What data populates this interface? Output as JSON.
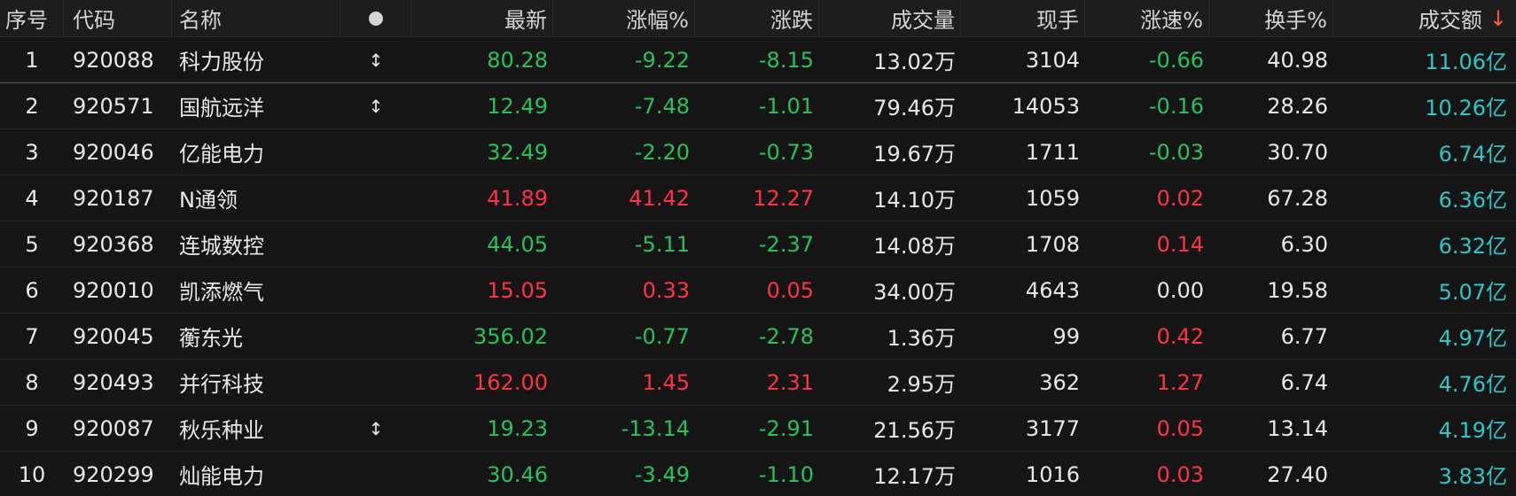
{
  "header": {
    "cols": [
      "序号",
      "代码",
      "名称",
      "",
      "最新",
      "涨幅%",
      "涨跌",
      "成交量",
      "现手",
      "涨速%",
      "换手%",
      "成交额"
    ],
    "sort_arrow": "↓",
    "dot_icon": "circle-icon"
  },
  "colors": {
    "up": "#ff3344",
    "down": "#28c25a",
    "amount": "#2fc6c6",
    "background": "#141414",
    "sort_arrow": "#ff5a3c"
  },
  "rows": [
    {
      "idx": "1",
      "code": "920088",
      "name": "科力股份",
      "marker": "↕",
      "last": "80.28",
      "pct": "-9.22",
      "chg": "-8.15",
      "vol": "13.02万",
      "hand": "3104",
      "speed": "-0.66",
      "turn": "40.98",
      "amt": "11.06亿",
      "dir": "down",
      "speed_dir": "down"
    },
    {
      "idx": "2",
      "code": "920571",
      "name": "国航远洋",
      "marker": "↕",
      "last": "12.49",
      "pct": "-7.48",
      "chg": "-1.01",
      "vol": "79.46万",
      "hand": "14053",
      "speed": "-0.16",
      "turn": "28.26",
      "amt": "10.26亿",
      "dir": "down",
      "speed_dir": "down"
    },
    {
      "idx": "3",
      "code": "920046",
      "name": "亿能电力",
      "marker": "",
      "last": "32.49",
      "pct": "-2.20",
      "chg": "-0.73",
      "vol": "19.67万",
      "hand": "1711",
      "speed": "-0.03",
      "turn": "30.70",
      "amt": "6.74亿",
      "dir": "down",
      "speed_dir": "down"
    },
    {
      "idx": "4",
      "code": "920187",
      "name": "N通领",
      "marker": "",
      "last": "41.89",
      "pct": "41.42",
      "chg": "12.27",
      "vol": "14.10万",
      "hand": "1059",
      "speed": "0.02",
      "turn": "67.28",
      "amt": "6.36亿",
      "dir": "up",
      "speed_dir": "up"
    },
    {
      "idx": "5",
      "code": "920368",
      "name": "连城数控",
      "marker": "",
      "last": "44.05",
      "pct": "-5.11",
      "chg": "-2.37",
      "vol": "14.08万",
      "hand": "1708",
      "speed": "0.14",
      "turn": "6.30",
      "amt": "6.32亿",
      "dir": "down",
      "speed_dir": "up"
    },
    {
      "idx": "6",
      "code": "920010",
      "name": "凯添燃气",
      "marker": "",
      "last": "15.05",
      "pct": "0.33",
      "chg": "0.05",
      "vol": "34.00万",
      "hand": "4643",
      "speed": "0.00",
      "turn": "19.58",
      "amt": "5.07亿",
      "dir": "up",
      "speed_dir": "flat"
    },
    {
      "idx": "7",
      "code": "920045",
      "name": "蘅东光",
      "marker": "",
      "last": "356.02",
      "pct": "-0.77",
      "chg": "-2.78",
      "vol": "1.36万",
      "hand": "99",
      "speed": "0.42",
      "turn": "6.77",
      "amt": "4.97亿",
      "dir": "down",
      "speed_dir": "up"
    },
    {
      "idx": "8",
      "code": "920493",
      "name": "并行科技",
      "marker": "",
      "last": "162.00",
      "pct": "1.45",
      "chg": "2.31",
      "vol": "2.95万",
      "hand": "362",
      "speed": "1.27",
      "turn": "6.74",
      "amt": "4.76亿",
      "dir": "up",
      "speed_dir": "up"
    },
    {
      "idx": "9",
      "code": "920087",
      "name": "秋乐种业",
      "marker": "↕",
      "last": "19.23",
      "pct": "-13.14",
      "chg": "-2.91",
      "vol": "21.56万",
      "hand": "3177",
      "speed": "0.05",
      "turn": "13.14",
      "amt": "4.19亿",
      "dir": "down",
      "speed_dir": "up"
    },
    {
      "idx": "10",
      "code": "920299",
      "name": "灿能电力",
      "marker": "",
      "last": "30.46",
      "pct": "-3.49",
      "chg": "-1.10",
      "vol": "12.17万",
      "hand": "1016",
      "speed": "0.03",
      "turn": "27.40",
      "amt": "3.83亿",
      "dir": "down",
      "speed_dir": "up"
    }
  ]
}
